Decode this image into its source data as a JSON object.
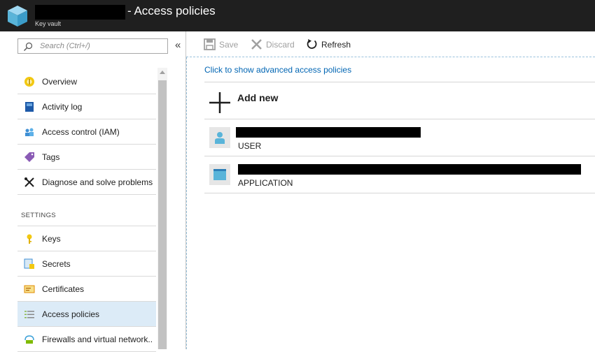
{
  "header": {
    "title": "- Access policies",
    "subtitle": "Key vault"
  },
  "sidebar": {
    "search_placeholder": "Search (Ctrl+/)",
    "collapse_glyph": "«",
    "items": [
      {
        "label": "Overview",
        "icon": "overview-icon"
      },
      {
        "label": "Activity log",
        "icon": "activity-log-icon"
      },
      {
        "label": "Access control (IAM)",
        "icon": "iam-icon"
      },
      {
        "label": "Tags",
        "icon": "tag-icon"
      },
      {
        "label": "Diagnose and solve problems",
        "icon": "wrench-icon"
      }
    ],
    "settings_heading": "SETTINGS",
    "settings_items": [
      {
        "label": "Keys",
        "icon": "key-icon"
      },
      {
        "label": "Secrets",
        "icon": "secret-icon"
      },
      {
        "label": "Certificates",
        "icon": "certificate-icon"
      },
      {
        "label": "Access policies",
        "icon": "access-policies-icon",
        "active": true
      },
      {
        "label": "Firewalls and virtual network..",
        "icon": "firewall-icon"
      }
    ]
  },
  "toolbar": {
    "save_label": "Save",
    "discard_label": "Discard",
    "refresh_label": "Refresh"
  },
  "main": {
    "advanced_link": "Click to show advanced access policies",
    "add_new_label": "Add new",
    "entries": [
      {
        "type": "USER"
      },
      {
        "type": "APPLICATION"
      }
    ]
  },
  "colors": {
    "header_bg": "#1f1f1f",
    "link": "#0065b3",
    "active_item_bg": "#dcebf7"
  }
}
